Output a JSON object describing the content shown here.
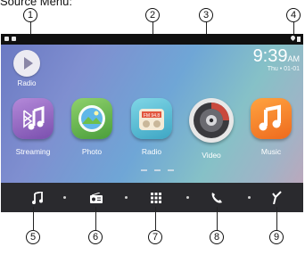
{
  "heading": "Source Menu:",
  "callouts": [
    "1",
    "2",
    "3",
    "4",
    "5",
    "6",
    "7",
    "8",
    "9"
  ],
  "status_bar": {
    "icons": [
      "notification-icon",
      "notification-icon",
      "location-icon",
      "lock-icon"
    ]
  },
  "radio_shortcut": {
    "label": "Radio",
    "icon": "play-icon"
  },
  "clock": {
    "time": "9:39",
    "ampm": "AM",
    "date": "Thu • 01-01"
  },
  "apps": [
    {
      "label": "Streaming",
      "icon": "bluetooth-music-icon"
    },
    {
      "label": "Photo",
      "icon": "photo-icon"
    },
    {
      "label": "Radio",
      "icon": "radio-icon",
      "display": "FM 94.8"
    },
    {
      "label": "Video",
      "icon": "video-icon"
    },
    {
      "label": "Music",
      "icon": "music-icon"
    }
  ],
  "dock": [
    {
      "icon": "music-note-icon"
    },
    {
      "icon": "radio-icon"
    },
    {
      "icon": "apps-grid-icon"
    },
    {
      "icon": "phone-icon"
    },
    {
      "icon": "navigation-icon"
    }
  ],
  "colors": {
    "dock_bg": "#2a2a2e",
    "statusbar_bg": "#101010",
    "music_tile": "#f08428",
    "streaming_tile": "#9b6bc8"
  }
}
